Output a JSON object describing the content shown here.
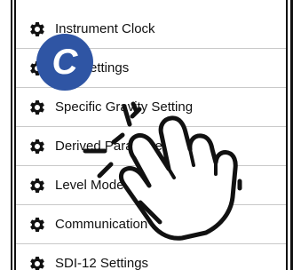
{
  "menu": {
    "items": [
      {
        "label": "Instrument Clock",
        "icon": "gear-icon"
      },
      {
        "label": "Settings",
        "icon": "gear-icon"
      },
      {
        "label": "Specific Gravity Setting",
        "icon": "gear-icon"
      },
      {
        "label": "Derived Parameters",
        "icon": "gear-icon"
      },
      {
        "label": "Level Mode",
        "icon": "gear-icon"
      },
      {
        "label": "Communication Settings",
        "icon": "gear-icon"
      },
      {
        "label": "SDI-12 Settings",
        "icon": "gear-icon"
      }
    ]
  },
  "badge": {
    "letter": "C",
    "color": "#2f55a4"
  },
  "overlay": {
    "icon": "tap-hand-icon"
  }
}
